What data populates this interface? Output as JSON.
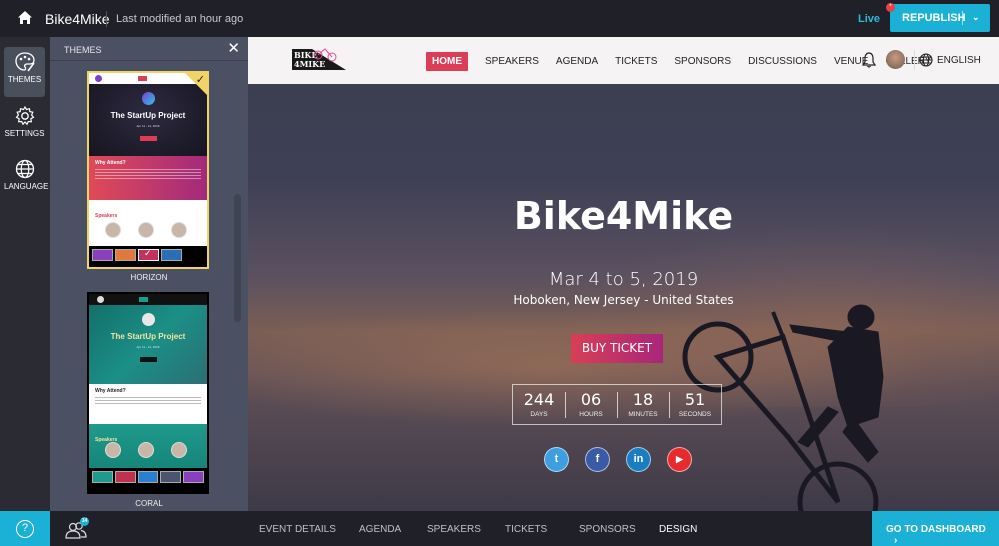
{
  "topbar": {
    "app_title": "Bike4Mike",
    "modified": "Last modified an hour ago",
    "live_label": "Live",
    "republish_label": "REPUBLISH",
    "republish_badge": "*"
  },
  "rail": {
    "items": [
      {
        "label": "THEMES",
        "icon": "palette-icon",
        "active": true
      },
      {
        "label": "SETTINGS",
        "icon": "gear-icon",
        "active": false
      },
      {
        "label": "LANGUAGE",
        "icon": "globe-icon",
        "active": false
      }
    ]
  },
  "themes_panel": {
    "title": "THEMES",
    "themes": [
      {
        "name": "HORIZON",
        "selected": true,
        "preview_title": "The StartUp Project",
        "preview_date": "Apr 11 - 12, 2018",
        "section_why": "Why Attend?",
        "section_speakers": "Speakers",
        "swatches": [
          "#8a3fbf",
          "#e07a3c",
          "#c2325a",
          "#2a6fb5"
        ],
        "selected_swatch": 2
      },
      {
        "name": "CORAL",
        "selected": false,
        "preview_title": "The StartUp Project",
        "preview_date": "Apr 11 - 12, 2018",
        "section_why": "Why Attend?",
        "section_speakers": "Speakers",
        "swatches": [
          "#1f9a8c",
          "#c0304f",
          "#2a7fcf",
          "#4a5670",
          "#8a3fbf"
        ]
      }
    ]
  },
  "site": {
    "nav": [
      "HOME",
      "SPEAKERS",
      "AGENDA",
      "TICKETS",
      "SPONSORS",
      "DISCUSSIONS",
      "VENUE",
      "GALLERY"
    ],
    "language": "ENGLISH",
    "logo_text_1": "BIKE",
    "logo_text_2": "4MIKE",
    "hero_title": "Bike4Mike",
    "hero_date": "Mar 4 to 5, 2019",
    "hero_location": "Hoboken, New Jersey - United States",
    "buy_label": "BUY TICKET",
    "countdown": [
      {
        "value": "244",
        "label": "DAYS"
      },
      {
        "value": "06",
        "label": "HOURS"
      },
      {
        "value": "18",
        "label": "MINUTES"
      },
      {
        "value": "51",
        "label": "SECONDS"
      }
    ],
    "socials": [
      {
        "name": "twitter",
        "glyph": "t",
        "color": "#3d9ee0"
      },
      {
        "name": "facebook",
        "glyph": "f",
        "color": "#3a5aa8"
      },
      {
        "name": "linkedin",
        "glyph": "in",
        "color": "#1a7dbf"
      },
      {
        "name": "youtube",
        "glyph": "▶",
        "color": "#e52b2b"
      }
    ]
  },
  "bottombar": {
    "users_count": "14",
    "tabs": [
      "EVENT DETAILS",
      "AGENDA",
      "SPEAKERS",
      "TICKETS",
      "SPONSORS",
      "DESIGN"
    ],
    "active_tab": "DESIGN",
    "dashboard_label": "GO TO DASHBOARD"
  },
  "colors": {
    "accent": "#1bb0d6",
    "nav_active": "#dd3c57",
    "theme_selected": "#f0d467"
  }
}
